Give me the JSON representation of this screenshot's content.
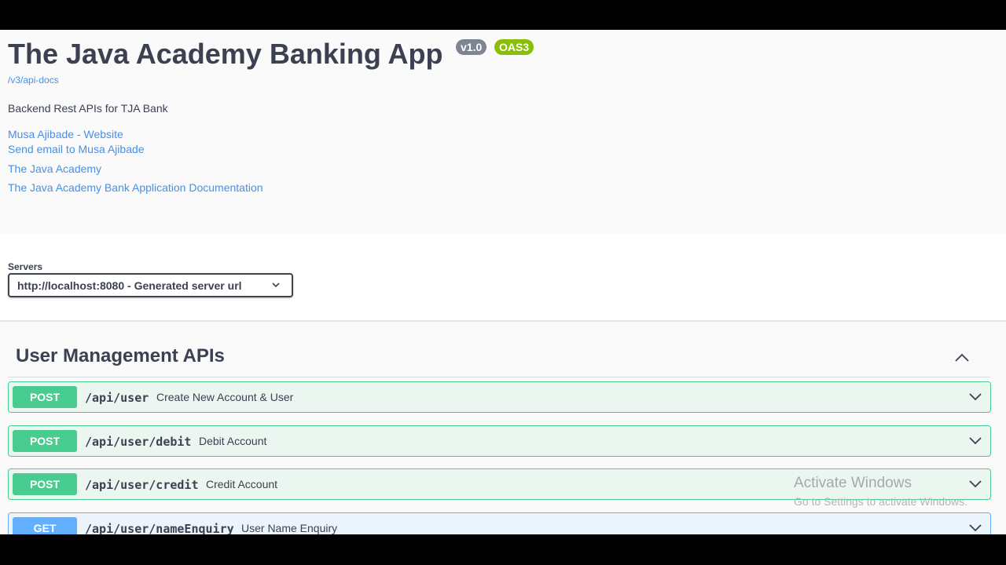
{
  "info": {
    "title": "The Java Academy Banking App",
    "version_badge": "v1.0",
    "oas_badge": "OAS3",
    "api_docs_link": "/v3/api-docs",
    "description": "Backend Rest APIs for TJA Bank",
    "links": [
      "Musa Ajibade - Website",
      "Send email to Musa Ajibade",
      "The Java Academy",
      "The Java Academy Bank Application Documentation"
    ]
  },
  "servers": {
    "label": "Servers",
    "selected": "http://localhost:8080 - Generated server url"
  },
  "tag": {
    "name": "User Management APIs"
  },
  "operations": [
    {
      "method": "POST",
      "path": "/api/user",
      "summary": "Create New Account & User"
    },
    {
      "method": "POST",
      "path": "/api/user/debit",
      "summary": "Debit Account"
    },
    {
      "method": "POST",
      "path": "/api/user/credit",
      "summary": "Credit Account"
    },
    {
      "method": "GET",
      "path": "/api/user/nameEnquiry",
      "summary": "User Name Enquiry"
    }
  ],
  "watermark": {
    "title": "Activate Windows",
    "subtitle": "Go to Settings to activate Windows."
  },
  "colors": {
    "post": "#49cc90",
    "get": "#61affe",
    "link": "#4990e2",
    "oas_badge": "#89bf04",
    "version_badge": "#7d8492"
  },
  "icons": [
    "chevron-down-icon",
    "chevron-up-icon"
  ]
}
